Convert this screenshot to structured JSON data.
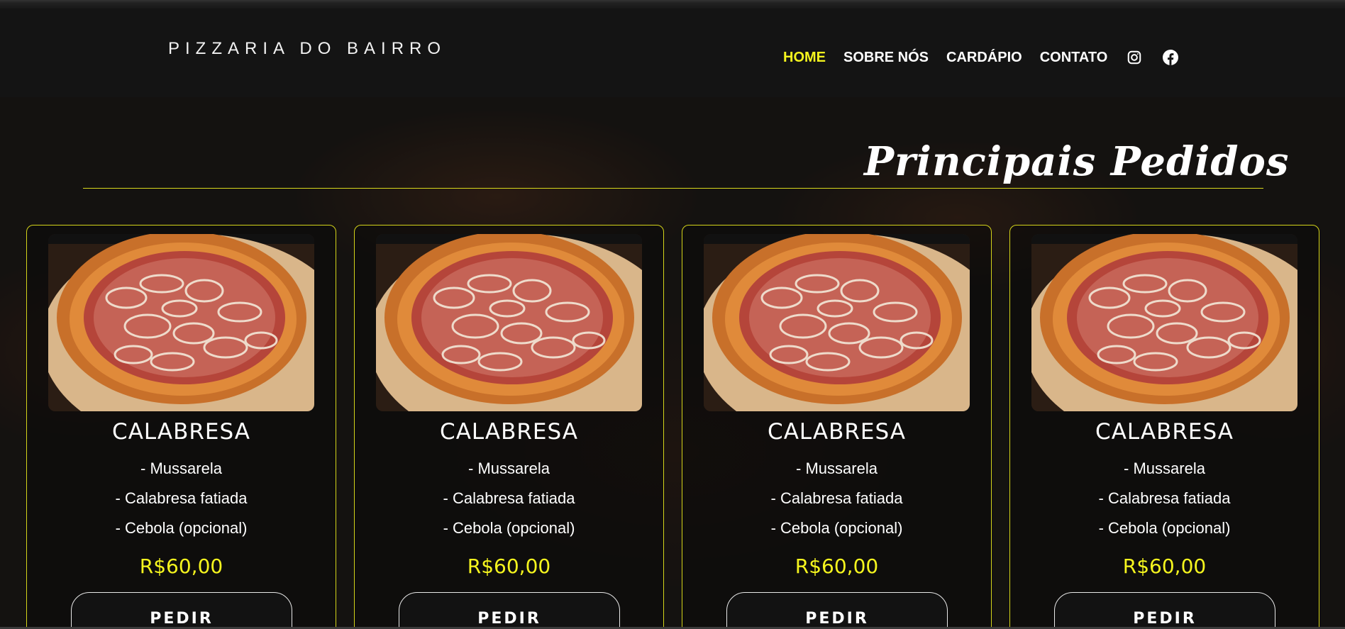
{
  "header": {
    "brand": "PIZZARIA DO BAIRRO",
    "nav": [
      {
        "label": "HOME",
        "active": true
      },
      {
        "label": "SOBRE NÓS",
        "active": false
      },
      {
        "label": "CARDÁPIO",
        "active": false
      },
      {
        "label": "CONTATO",
        "active": false
      }
    ],
    "social": [
      "instagram-icon",
      "facebook-icon"
    ]
  },
  "section": {
    "title": "Principais Pedidos"
  },
  "cards": [
    {
      "name": "CALABRESA",
      "ingredients": [
        "- Mussarela",
        "- Calabresa fatiada",
        "- Cebola (opcional)"
      ],
      "price": "R$60,00",
      "button": "PEDIR"
    },
    {
      "name": "CALABRESA",
      "ingredients": [
        "- Mussarela",
        "- Calabresa fatiada",
        "- Cebola (opcional)"
      ],
      "price": "R$60,00",
      "button": "PEDIR"
    },
    {
      "name": "CALABRESA",
      "ingredients": [
        "- Mussarela",
        "- Calabresa fatiada",
        "- Cebola (opcional)"
      ],
      "price": "R$60,00",
      "button": "PEDIR"
    },
    {
      "name": "CALABRESA",
      "ingredients": [
        "- Mussarela",
        "- Calabresa fatiada",
        "- Cebola (opcional)"
      ],
      "price": "R$60,00",
      "button": "PEDIR"
    }
  ],
  "colors": {
    "accent": "#f5f51e",
    "background": "#141414",
    "card_border": "#d4d41a"
  }
}
